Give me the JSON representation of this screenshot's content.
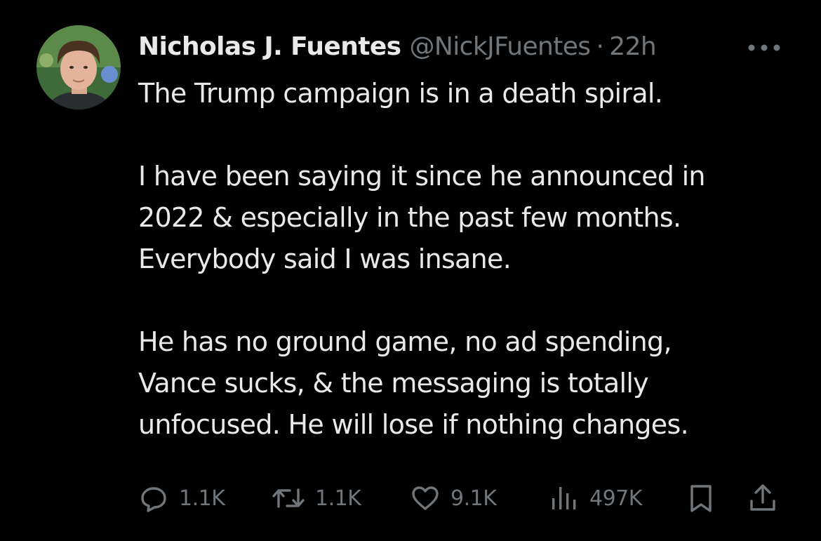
{
  "author": {
    "display_name": "Nicholas J. Fuentes",
    "handle": "@NickJFuentes",
    "separator": "·",
    "timestamp": "22h"
  },
  "tweet": {
    "paragraphs": [
      [
        "The Trump campaign is in a death spiral."
      ],
      [
        "I have been saying it since he announced in",
        "2022 & especially in the past few months.",
        "Everybody said I was insane."
      ],
      [
        "He has no ground game, no ad spending,",
        "Vance sucks, & the messaging is totally",
        "unfocused. He will lose if nothing changes."
      ]
    ]
  },
  "stats": {
    "replies": "1.1K",
    "reposts": "1.1K",
    "likes": "9.1K",
    "views": "497K"
  },
  "icons": {
    "more": "more-horizontal-icon",
    "reply": "reply-icon",
    "repost": "repost-icon",
    "like": "heart-icon",
    "views": "views-icon",
    "bookmark": "bookmark-icon",
    "share": "share-icon"
  },
  "colors": {
    "background": "#000000",
    "primary_text": "#e7e9ea",
    "secondary_text": "#71767b"
  }
}
